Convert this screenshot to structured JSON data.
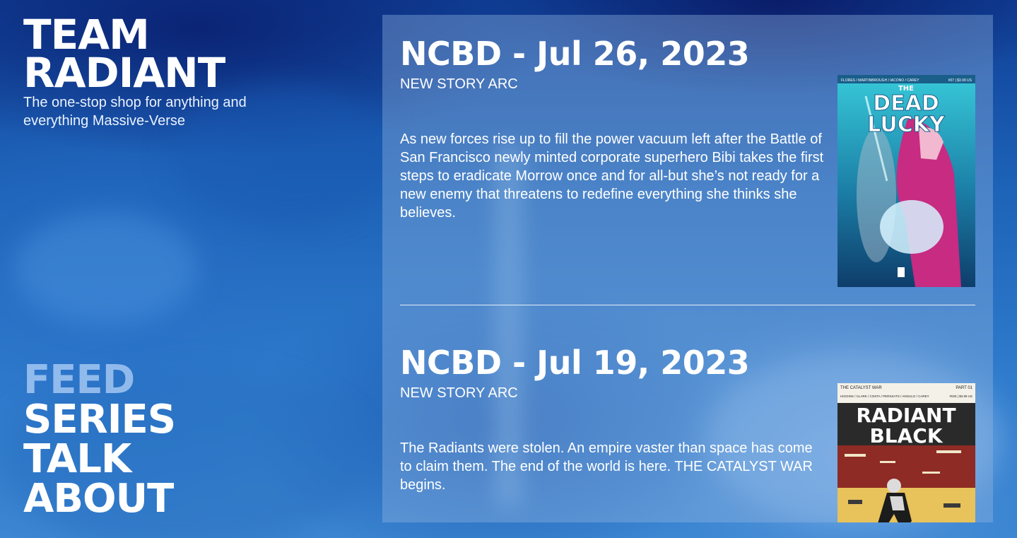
{
  "brand": {
    "title_line1": "TEAM",
    "title_line2": "RADIANT",
    "tagline": "The one-stop shop for anything and everything Massive-Verse"
  },
  "nav": {
    "items": [
      {
        "label": "FEED",
        "active": true
      },
      {
        "label": "SERIES",
        "active": false
      },
      {
        "label": "TALK",
        "active": false
      },
      {
        "label": "ABOUT",
        "active": false
      }
    ]
  },
  "posts": [
    {
      "title": "NCBD - Jul 26, 2023",
      "tag": "NEW STORY ARC",
      "body": "As new forces rise up to fill the power vacuum left after the Battle of San Francisco newly minted corporate superhero Bibi takes the first steps to eradicate Morrow once and for all-but she’s not ready for a new enemy that threatens to redefine everything she thinks she believes.",
      "cover": {
        "title": "THE DEAD LUCKY",
        "credits": "FLORES / MARTINBROUGH / IACONO / CAREY",
        "issue": "#07 | $3.99 US",
        "publisher_icon": "image-comics-logo-icon"
      }
    },
    {
      "title": "NCBD - Jul 19, 2023",
      "tag": "NEW STORY ARC",
      "body": "The Radiants were stolen. An empire vaster than space has come to claim them. The end of the world is here. THE CATALYST WAR begins.",
      "cover": {
        "kicker": "THE CATALYST WAR",
        "part": "PART 01",
        "credits": "HIGGINS / CLARK / COSTA / PERSSATS / ANGULO / CAREY",
        "issue": "#025 | $3.99 US",
        "title_line1": "RADIANT",
        "title_line2": "BLACK"
      }
    }
  ],
  "colors": {
    "panel": "#96b9e1",
    "text": "#ffffff",
    "nav_active": "#c8e1ff"
  }
}
